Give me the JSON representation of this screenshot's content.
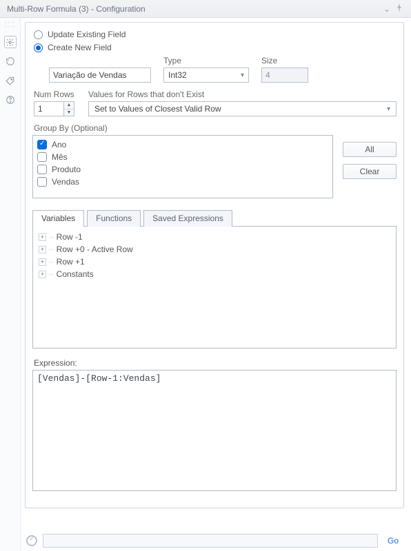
{
  "titlebar": {
    "title": "Multi-Row Formula (3) - Configuration"
  },
  "mode": {
    "update_label": "Update Existing Field",
    "create_label": "Create New  Field",
    "selected": "create"
  },
  "newfield": {
    "name_value": "Variação de Vendas",
    "type_label": "Type",
    "type_value": "Int32",
    "size_label": "Size",
    "size_value": "4"
  },
  "numrows": {
    "label": "Num Rows",
    "value": "1"
  },
  "valuesmissing": {
    "label": "Values for Rows that don't Exist",
    "value": "Set to Values of Closest Valid Row"
  },
  "groupby": {
    "label": "Group By (Optional)",
    "items": [
      {
        "label": "Ano",
        "checked": true
      },
      {
        "label": "Mês",
        "checked": false
      },
      {
        "label": "Produto",
        "checked": false
      },
      {
        "label": "Vendas",
        "checked": false
      }
    ],
    "all_btn": "All",
    "clear_btn": "Clear"
  },
  "tabs": {
    "variables": "Variables",
    "functions": "Functions",
    "saved": "Saved Expressions",
    "tree": [
      "Row -1",
      "Row +0 - Active Row",
      "Row +1",
      "Constants"
    ]
  },
  "expression": {
    "label": "Expression:",
    "value": "[Vendas]-[Row-1:Vendas]"
  },
  "footer": {
    "go": "Go"
  }
}
